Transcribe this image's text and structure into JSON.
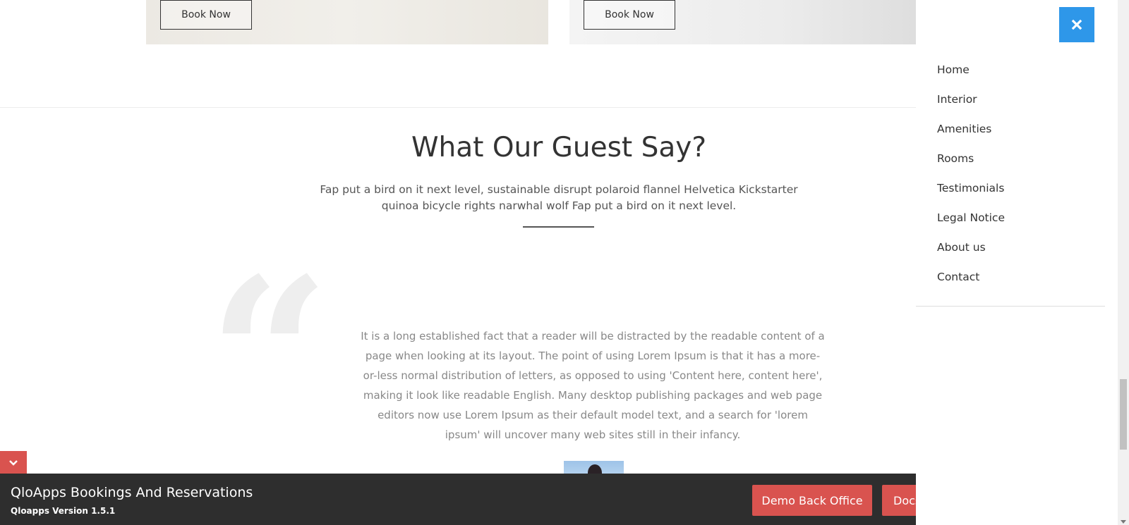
{
  "cards": [
    {
      "button_label": "Book Now"
    },
    {
      "button_label": "Book Now"
    }
  ],
  "testimonials": {
    "title": "What Our Guest Say?",
    "subtitle": "Fap put a bird on it next level, sustainable disrupt polaroid flannel Helvetica Kickstarter quinoa bicycle rights narwhal wolf Fap put a bird on it next level.",
    "quote_text": "It is a long established fact that a reader will be distracted by the readable content of a page when looking at its layout. The point of using Lorem Ipsum is that it has a more-or-less normal distribution of letters, as opposed to using 'Content here, content here', making it look like readable English. Many desktop publishing packages and web page editors now use Lorem Ipsum as their default model text, and a search for 'lorem ipsum' will uncover many web sites still in their infancy.",
    "quote_mark": "“"
  },
  "bottom_bar": {
    "title": "QloApps Bookings And Reservations",
    "version": "Qloapps Version 1.5.1",
    "demo_button": "Demo Back Office",
    "docs_button": "Docs"
  },
  "menu": {
    "items": [
      "Home",
      "Interior",
      "Amenities",
      "Rooms",
      "Testimonials",
      "Legal Notice",
      "About us",
      "Contact"
    ]
  },
  "colors": {
    "accent_blue": "#2e97e9",
    "accent_red": "#d9534f",
    "bar_dark": "#2e2e2e"
  },
  "icons": {
    "close": "close-icon",
    "collapse": "chevron-down-icon"
  }
}
